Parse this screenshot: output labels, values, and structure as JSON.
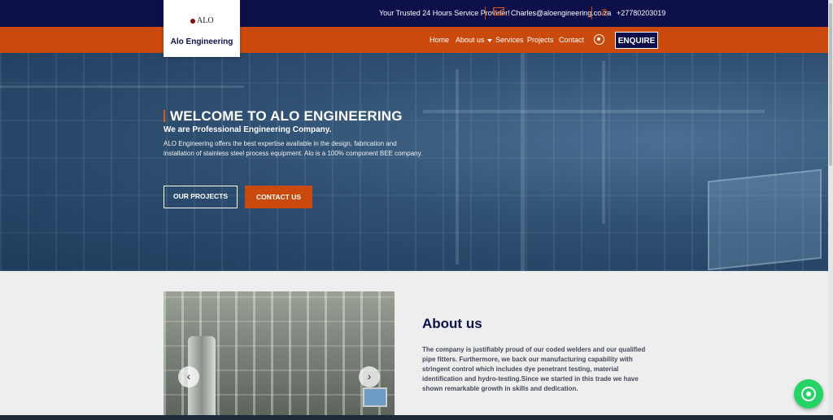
{
  "topbar": {
    "tagline": "Your Trusted 24 Hours Service Provider!",
    "email": "Charles@aloengineering.co.za",
    "phone": "+27780203019",
    "mail_icon": "mail-icon",
    "phone_icon": "phone-icon"
  },
  "logo": {
    "mark": "ALO",
    "name": "Alo Engineering"
  },
  "nav": {
    "items": [
      "Home",
      "About us",
      "Services",
      "Projects",
      "Contact"
    ],
    "enquire": "ENQUIRE",
    "whatsapp_icon": "whatsapp-icon"
  },
  "hero": {
    "title": "WELCOME TO ALO ENGINEERING",
    "subtitle": "We are Professional Engineering Company.",
    "description": "ALO Engineering offers the best expertise available in the design, fabrication and installation of stainless steel process equipment. Alo is a 100% component BEE company.",
    "btn_projects": "OUR PROJECTS",
    "btn_contact": "CONTACT US"
  },
  "about": {
    "title": "About us",
    "text": "The company is justifiably proud of our coded welders and our qualified pipe fitters. Furthermore, we back our manufacturing capability with stringent control which includes dye penetrant testing, material identification and hydro-testing.Since we started in this trade we have shown remarkable growth in skills and dedication.",
    "prev": "‹",
    "next": "›"
  },
  "colors": {
    "navy": "#0d0f4a",
    "orange": "#c94a0c",
    "whatsapp": "#25d366"
  }
}
